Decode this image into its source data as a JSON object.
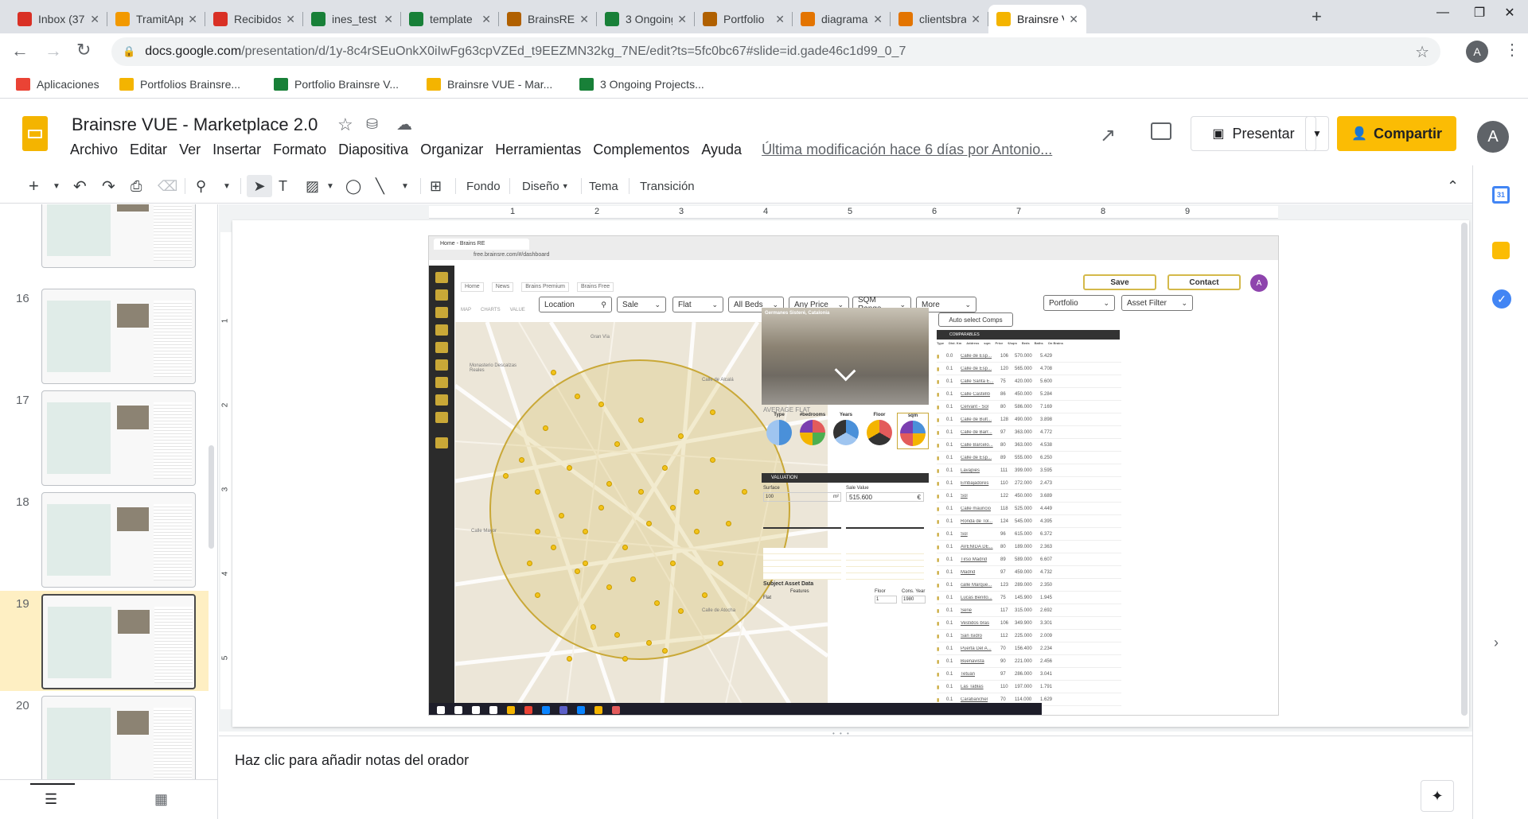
{
  "browser": {
    "tabs": [
      {
        "label": "Inbox (370",
        "favicon_color": "#d93025"
      },
      {
        "label": "TramitApp",
        "favicon_color": "#f29900"
      },
      {
        "label": "Recibidos",
        "favicon_color": "#d93025"
      },
      {
        "label": "ines_test",
        "favicon_color": "#188038"
      },
      {
        "label": "template",
        "favicon_color": "#188038"
      },
      {
        "label": "BrainsRE",
        "favicon_color": "#b06000"
      },
      {
        "label": "3 Ongoing",
        "favicon_color": "#188038"
      },
      {
        "label": "Portfolio",
        "favicon_color": "#b06000"
      },
      {
        "label": "diagrama",
        "favicon_color": "#e37400"
      },
      {
        "label": "clientsbra",
        "favicon_color": "#e37400"
      },
      {
        "label": "Brainsre V",
        "favicon_color": "#f4b400"
      }
    ],
    "new_tab": "+",
    "window_controls": {
      "minimize": "—",
      "maximize": "❐",
      "close": "✕"
    },
    "url_host": "docs.google.com",
    "url_path": "/presentation/d/1y-8c4rSEuOnkX0iIwFg63cpVZEd_t9EEZMN32kg_7NE/edit?ts=5fc0bc67#slide=id.gade46c1d99_0_7",
    "profile_initial": "A",
    "bookmarks": [
      {
        "label": "Aplicaciones",
        "color": "#ea4335"
      },
      {
        "label": "Portfolios Brainsre...",
        "color": "#f4b400"
      },
      {
        "label": "Portfolio Brainsre V...",
        "color": "#188038"
      },
      {
        "label": "Brainsre VUE - Mar...",
        "color": "#f4b400"
      },
      {
        "label": "3 Ongoing Projects...",
        "color": "#188038"
      }
    ]
  },
  "slides_app": {
    "doc_title": "Brainsre VUE - Marketplace 2.0",
    "menu": [
      "Archivo",
      "Editar",
      "Ver",
      "Insertar",
      "Formato",
      "Diapositiva",
      "Organizar",
      "Herramientas",
      "Complementos",
      "Ayuda"
    ],
    "last_modified": "Última modificación hace 6 días por Antonio...",
    "present_label": "Presentar",
    "share_label": "Compartir",
    "account_initial": "A",
    "accent_color": "#fbbc04",
    "toolbar": {
      "background": "Fondo",
      "layout": "Diseño",
      "theme": "Tema",
      "transition": "Transición"
    },
    "ruler_ticks": [
      "1",
      "2",
      "3",
      "4",
      "5",
      "6",
      "7",
      "8",
      "9"
    ],
    "ruler_v_ticks": [
      "1",
      "2",
      "3",
      "4",
      "5"
    ],
    "slides": [
      {
        "number": ""
      },
      {
        "number": "16"
      },
      {
        "number": "17"
      },
      {
        "number": "18"
      },
      {
        "number": "19"
      },
      {
        "number": "20"
      }
    ],
    "speaker_notes_placeholder": "Haz clic para añadir notas del orador"
  },
  "embedded_screenshot": {
    "browser_tab": "Home - Brains RE",
    "url": "free.brainsre.com/#/dashboard",
    "nav_tabs": [
      "Home",
      "News",
      "Brains Premium",
      "Brains Free"
    ],
    "mode_labels": [
      "MAP",
      "CHARTS",
      "VALUE"
    ],
    "save_label": "Save",
    "contact_label": "Contact",
    "avatar_initial": "A",
    "filters": {
      "location": "Location",
      "operation": "Sale",
      "type": "Flat",
      "beds": "All Beds",
      "price": "Any Price",
      "sqm": "SQM Range",
      "more": "More",
      "portfolio": "Portfolio",
      "asset_filter": "Asset Filter"
    },
    "auto_select": "Auto select Comps",
    "comparables_title": "COMPARABLES",
    "street_view_title": "Germanes Sisteré, Catalonia",
    "average_flat": "AVERAGE FLAT",
    "pie_labels": [
      "Type",
      "#bedrooms",
      "Years",
      "Floor",
      "sqm"
    ],
    "valuation": "VALUATION",
    "surface_label": "Surface",
    "surface_value": "100",
    "surface_unit": "m²",
    "sale_value_label": "Sale Value",
    "sale_value": "515.600",
    "currency": "€",
    "subject_asset": "Subject Asset Data",
    "features_label": "Features",
    "floor_label": "Floor",
    "cons_year_label": "Cons. Year",
    "type_value": "Flat",
    "floor_value": "1",
    "year_value": "1980",
    "map_labels": [
      "Monasterio Descalzas Reales",
      "Calle Mayor",
      "Calle de Alcalá",
      "Gran Vía",
      "Calle de Atocha"
    ],
    "comparables_columns": [
      "Type",
      "Dist. Km",
      "Address",
      "sqm",
      "Price",
      "€/sqm",
      "Beds",
      "Baths",
      "On Brains"
    ],
    "comparables": [
      {
        "dist": "0.0",
        "address": "Calle de Esp...",
        "sqm": "106",
        "price": "570.000",
        "eur_sqm": "5.429"
      },
      {
        "dist": "0.1",
        "address": "Calle de Esp...",
        "sqm": "120",
        "price": "565.000",
        "eur_sqm": "4.708"
      },
      {
        "dist": "0.1",
        "address": "Calle Santa E...",
        "sqm": "75",
        "price": "420.000",
        "eur_sqm": "5.600"
      },
      {
        "dist": "0.1",
        "address": "Calle Castelló",
        "sqm": "86",
        "price": "450.000",
        "eur_sqm": "5.284"
      },
      {
        "dist": "0.1",
        "address": "Cervant - Sol",
        "sqm": "80",
        "price": "586.000",
        "eur_sqm": "7.169"
      },
      {
        "dist": "0.1",
        "address": "Calle de Bult...",
        "sqm": "128",
        "price": "490.000",
        "eur_sqm": "3.898"
      },
      {
        "dist": "0.1",
        "address": "Calle de Barr...",
        "sqm": "97",
        "price": "363.000",
        "eur_sqm": "4.772"
      },
      {
        "dist": "0.1",
        "address": "Calle Barcelo...",
        "sqm": "80",
        "price": "363.000",
        "eur_sqm": "4.538"
      },
      {
        "dist": "0.1",
        "address": "Calle de Esp...",
        "sqm": "89",
        "price": "555.000",
        "eur_sqm": "6.250"
      },
      {
        "dist": "0.1",
        "address": "Lavapiés",
        "sqm": "111",
        "price": "399.000",
        "eur_sqm": "3.595"
      },
      {
        "dist": "0.1",
        "address": "Embajadores",
        "sqm": "110",
        "price": "272.000",
        "eur_sqm": "2.473"
      },
      {
        "dist": "0.1",
        "address": "Sol",
        "sqm": "122",
        "price": "450.000",
        "eur_sqm": "3.689"
      },
      {
        "dist": "0.1",
        "address": "Calle mauricio",
        "sqm": "118",
        "price": "525.000",
        "eur_sqm": "4.449"
      },
      {
        "dist": "0.1",
        "address": "Ronda de Tol...",
        "sqm": "124",
        "price": "545.000",
        "eur_sqm": "4.395"
      },
      {
        "dist": "0.1",
        "address": "Sol",
        "sqm": "96",
        "price": "615.000",
        "eur_sqm": "6.372"
      },
      {
        "dist": "0.1",
        "address": "AVENIDA DE...",
        "sqm": "80",
        "price": "189.000",
        "eur_sqm": "2.363"
      },
      {
        "dist": "0.1",
        "address": "Tirso Madrid",
        "sqm": "89",
        "price": "589.000",
        "eur_sqm": "6.607"
      },
      {
        "dist": "0.1",
        "address": "Madrid",
        "sqm": "97",
        "price": "459.000",
        "eur_sqm": "4.732"
      },
      {
        "dist": "0.1",
        "address": "calle Marque...",
        "sqm": "123",
        "price": "289.000",
        "eur_sqm": "2.350"
      },
      {
        "dist": "0.1",
        "address": "Lucas Benito...",
        "sqm": "75",
        "price": "145.900",
        "eur_sqm": "1.945"
      },
      {
        "dist": "0.1",
        "address": "Serie",
        "sqm": "117",
        "price": "315.000",
        "eur_sqm": "2.692"
      },
      {
        "dist": "0.1",
        "address": "Vestidos bras",
        "sqm": "106",
        "price": "349.900",
        "eur_sqm": "3.301"
      },
      {
        "dist": "0.1",
        "address": "San Isidro",
        "sqm": "112",
        "price": "225.000",
        "eur_sqm": "2.009"
      },
      {
        "dist": "0.1",
        "address": "Puerta Del A...",
        "sqm": "70",
        "price": "156.400",
        "eur_sqm": "2.234"
      },
      {
        "dist": "0.1",
        "address": "Buenavista",
        "sqm": "90",
        "price": "221.000",
        "eur_sqm": "2.456"
      },
      {
        "dist": "0.1",
        "address": "Tetuán",
        "sqm": "97",
        "price": "286.000",
        "eur_sqm": "3.041"
      },
      {
        "dist": "0.1",
        "address": "Las Tablas",
        "sqm": "110",
        "price": "197.000",
        "eur_sqm": "1.791"
      },
      {
        "dist": "0.1",
        "address": "Carabanchel",
        "sqm": "70",
        "price": "114.000",
        "eur_sqm": "1.629"
      }
    ]
  }
}
